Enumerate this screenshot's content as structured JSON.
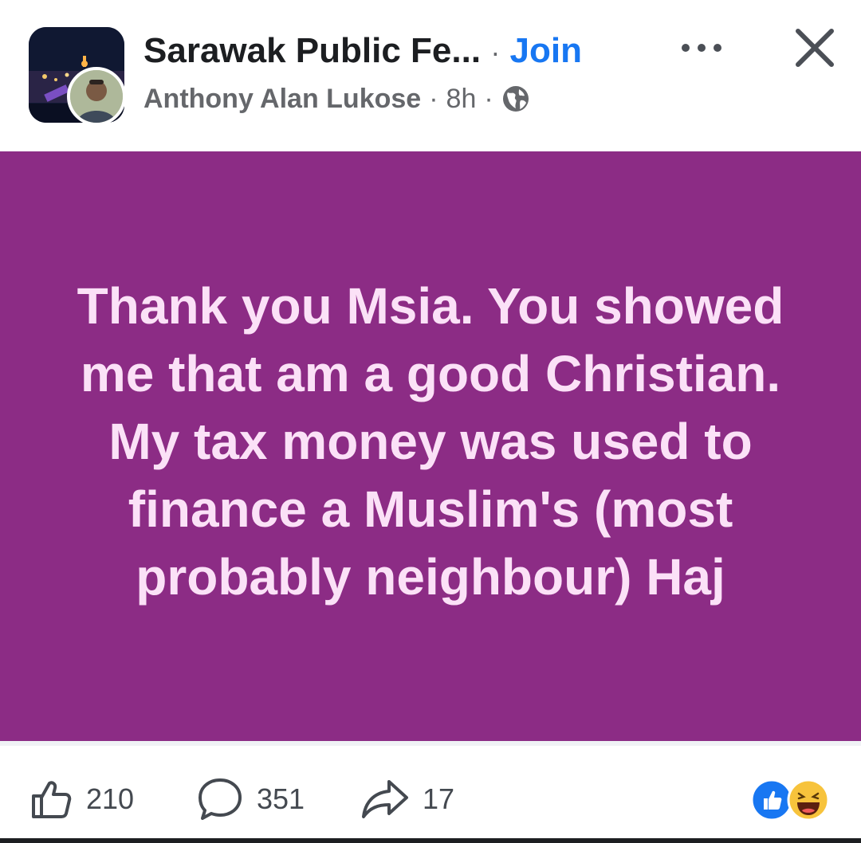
{
  "header": {
    "group_name": "Sarawak Public Fe...",
    "separator": "·",
    "join_label": "Join",
    "author": "Anthony Alan Lukose",
    "time": "8h",
    "meta_separator": "·",
    "visibility_icon": "globe-icon",
    "more_icon": "more-horizontal-icon",
    "close_icon": "close-icon"
  },
  "post": {
    "text": "Thank you Msia. You showed me that am a good Christian. My tax money was used to finance a Muslim's (most probably neighbour) Haj",
    "background_color": "#8c2c85",
    "text_color": "#fbe1f7"
  },
  "footer": {
    "like_count": "210",
    "comment_count": "351",
    "share_count": "17",
    "like_icon": "thumbs-up-icon",
    "comment_icon": "comment-icon",
    "share_icon": "share-icon",
    "reactions": [
      "like-reaction-icon",
      "haha-reaction-icon"
    ]
  },
  "colors": {
    "accent": "#1877f2",
    "secondary_text": "#65676b"
  }
}
